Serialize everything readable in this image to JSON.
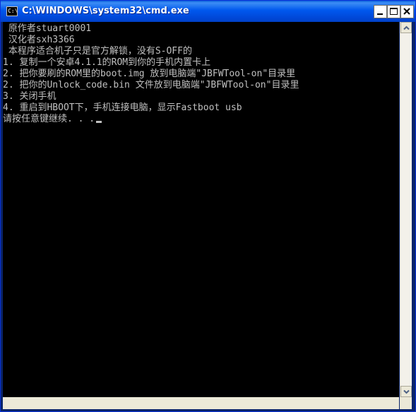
{
  "window": {
    "title": "C:\\WINDOWS\\system32\\cmd.exe",
    "icon": "cmd-icon",
    "icon_glyph": "C:\\",
    "controls": {
      "minimize_icon": "minimize-icon",
      "maximize_icon": "maximize-icon",
      "close_icon": "close-icon"
    }
  },
  "console": {
    "colors": {
      "background": "#000000",
      "foreground": "#c0c0c0"
    },
    "lines": [
      " 原作者stuart0001",
      " 汉化者sxh3366",
      " 本程序适合机子只是官方解锁，没有S-OFF的",
      "1. 复制一个安卓4.1.1的ROM到你的手机内置卡上",
      "2. 把你要刷的ROM里的boot.img 放到电脑端\"JBFWTool-on\"目录里",
      "2. 把你的Unlock_code.bin 文件放到电脑端\"JBFWTool-on\"目录里",
      "3. 关闭手机",
      "4. 重启到HBOOT下，手机连接电脑，显示Fastboot usb",
      "请按任意键继续. . ."
    ]
  },
  "scrollbar": {
    "up_icon": "scroll-up-arrow-icon",
    "down_icon": "scroll-down-arrow-icon"
  }
}
